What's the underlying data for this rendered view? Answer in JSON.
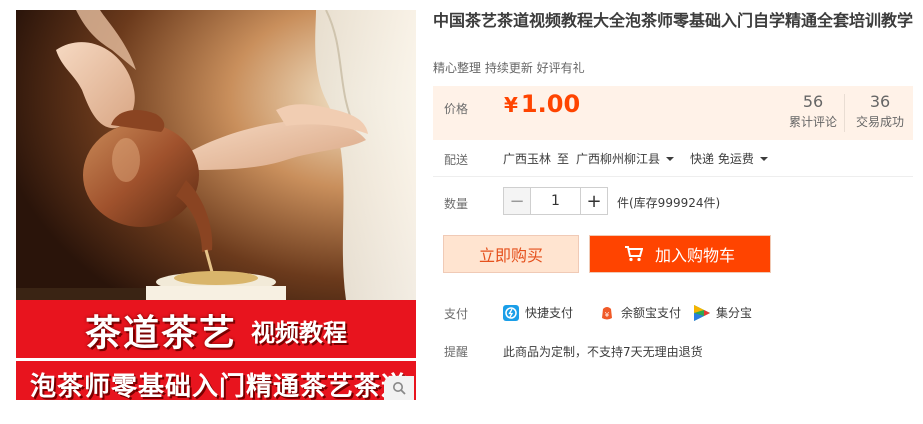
{
  "product": {
    "title": "中国茶艺茶道视频教程大全泡茶师零基础入门自学精通全套培训教学",
    "subtitle": "精心整理 持续更新 好评有礼"
  },
  "image": {
    "banner_big": "茶道茶艺",
    "banner_small": "视频教程",
    "banner_line2": "泡茶师零基础入门精通茶艺茶道"
  },
  "price": {
    "label": "价格",
    "currency": "¥",
    "amount": "1.00",
    "color": "#ff4400"
  },
  "stats": [
    {
      "value": "56",
      "label": "累计评论"
    },
    {
      "value": "36",
      "label": "交易成功"
    }
  ],
  "shipping": {
    "label": "配送",
    "from": "广西玉林",
    "to_word": "至",
    "destination": "广西柳州柳江县",
    "method": "快递 免运费"
  },
  "quantity": {
    "label": "数量",
    "value": "1",
    "minus": "−",
    "plus": "+",
    "unit_stock": "件(库存999924件)"
  },
  "actions": {
    "buy_now": "立即购买",
    "add_to_cart": "加入购物车"
  },
  "payment": {
    "label": "支付",
    "methods": [
      {
        "icon": "quick-pay-icon",
        "label": "快捷支付"
      },
      {
        "icon": "yuebao-icon",
        "label": "余额宝支付"
      },
      {
        "icon": "jifenbao-icon",
        "label": "集分宝"
      }
    ]
  },
  "reminder": {
    "label": "提醒",
    "text": "此商品为定制，不支持7天无理由退货"
  },
  "colors": {
    "accent": "#ff4400",
    "price_bg": "#fff2e8",
    "banner_red": "#e8141e"
  }
}
